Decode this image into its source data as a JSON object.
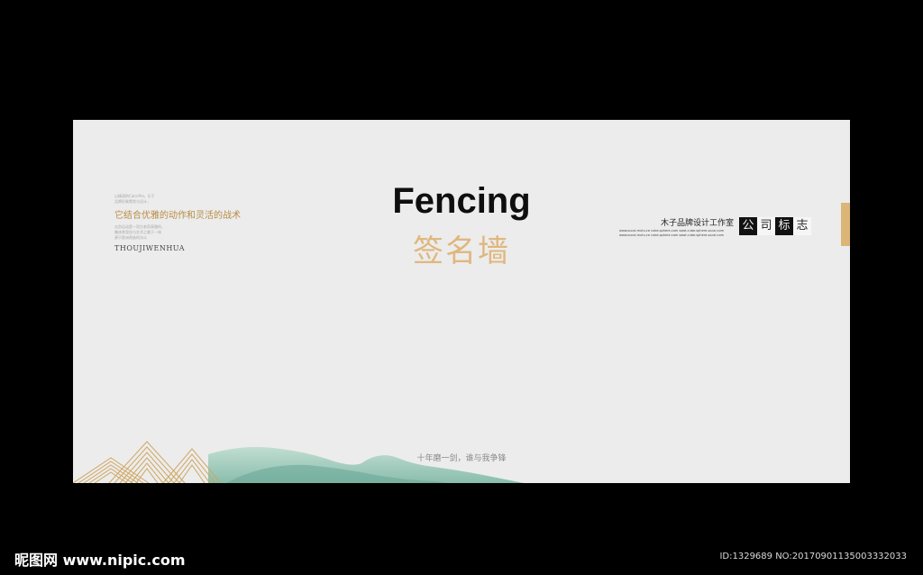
{
  "title_en": "Fencing",
  "title_cn": "签名墙",
  "left_block": {
    "tiny_lines_top": [
      "以精湛的ColorPro，乐于",
      "品牌形象策划与设计，"
    ],
    "slogan": "它结合优雅的动作和灵活的战术",
    "tiny_lines_bottom": [
      "击剑运动是一项古老而高雅的，",
      "集体育竞技与艺术之美于一体",
      "源于欧洲贵族的决斗"
    ],
    "english": "THOUJIWENHUA"
  },
  "right_block": {
    "studio": "木子品牌设计工作室",
    "tiny_line_1": "www.sucai.mutu.ce cube.sphere.com swot.cube.sphere.sucai.com",
    "tiny_line_2": "www.sucai.mutu.ce cube.sphere.com swot.cube.sphere.sucai.com",
    "logo_chars": [
      "公",
      "司",
      "标",
      "志"
    ]
  },
  "bottom_slogan": "十年磨一剑，谁与我争锋",
  "footer": {
    "brand": "昵图网 www.nipic.com",
    "id_text": "ID:1329689 NO:20170901135003332033"
  },
  "colors": {
    "gold": "#dfb77e",
    "background": "#ececec",
    "mountain_green": "#9cc9b9"
  }
}
